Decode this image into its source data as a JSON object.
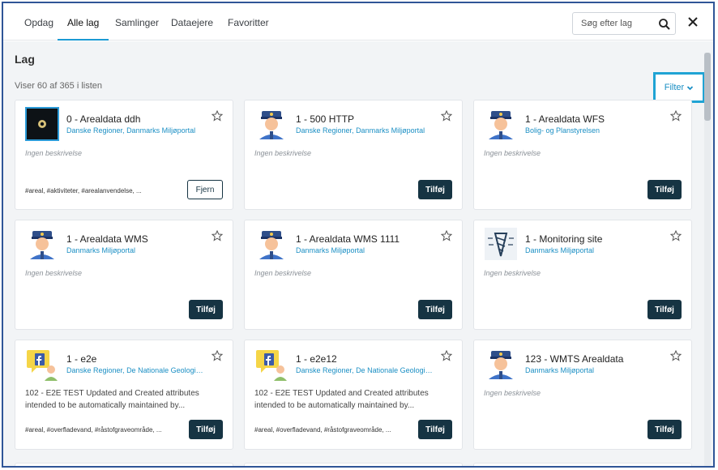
{
  "tabs": [
    "Opdag",
    "Alle lag",
    "Samlinger",
    "Dataejere",
    "Favoritter"
  ],
  "search": {
    "placeholder": "Søg efter lag"
  },
  "heading": "Lag",
  "count_text": "Viser 60 af 365 i listen",
  "filter_label": "Filter",
  "cards": [
    {
      "title": "0 - Arealdata ddh",
      "icon": "dataset-thumbnail-icon",
      "owners": [
        "Danske Regioner",
        "Danmarks Miljøportal"
      ],
      "description": "Ingen beskrivelse",
      "tags": "#areal, #aktiviteter, #arealanvendelse, ...",
      "button": "Fjern"
    },
    {
      "title": "1 - 500 HTTP",
      "icon": "police-officer-avatar-icon",
      "owners": [
        "Danske Regioner",
        "Danmarks Miljøportal"
      ],
      "description": "Ingen beskrivelse",
      "tags": "",
      "button": "Tilføj"
    },
    {
      "title": "1 - Arealdata WFS",
      "icon": "police-officer-avatar-icon",
      "owners": [
        "Bolig- og Planstyrelsen"
      ],
      "description": "Ingen beskrivelse",
      "tags": "",
      "button": "Tilføj"
    },
    {
      "title": "1 - Arealdata WMS",
      "icon": "police-officer-avatar-icon",
      "owners": [
        "Danmarks Miljøportal"
      ],
      "description": "Ingen beskrivelse",
      "tags": "",
      "button": "Tilføj"
    },
    {
      "title": "1 - Arealdata WMS 1111",
      "icon": "police-officer-avatar-icon",
      "owners": [
        "Danmarks Miljøportal"
      ],
      "description": "Ingen beskrivelse",
      "tags": "",
      "button": "Tilføj"
    },
    {
      "title": "1 - Monitoring site",
      "icon": "drill-logo-icon",
      "owners": [
        "Danmarks Miljøportal"
      ],
      "description": "Ingen beskrivelse",
      "tags": "",
      "button": "Tilføj"
    },
    {
      "title": "1 - e2e",
      "icon": "facebook-user-icon",
      "owners": [
        "Danske Regioner",
        "De Nationale Geologiske Undersøgelser"
      ],
      "description": "102 - E2E TEST Updated and Created attributes intended to be automatically maintained by...",
      "tags": "#areal, #overfladevand, #råstofgraveområde, ...",
      "button": "Tilføj"
    },
    {
      "title": "1 - e2e12",
      "icon": "facebook-user-icon",
      "owners": [
        "Danske Regioner",
        "De Nationale Geologiske Undersøgelser"
      ],
      "description": "102 - E2E TEST Updated and Created attributes intended to be automatically maintained by...",
      "tags": "#areal, #overfladevand, #råstofgraveområde, ...",
      "button": "Tilføj"
    },
    {
      "title": "123 - WMTS Arealdata",
      "icon": "police-officer-avatar-icon",
      "owners": [
        "Danmarks Miljøportal"
      ],
      "description": "Ingen beskrivelse",
      "tags": "",
      "button": "Tilføj"
    }
  ],
  "colors": {
    "accent": "#1b9ad3",
    "button_dark": "#163443",
    "link": "#1b8fc4",
    "filter_border": "#1fa3d4"
  }
}
